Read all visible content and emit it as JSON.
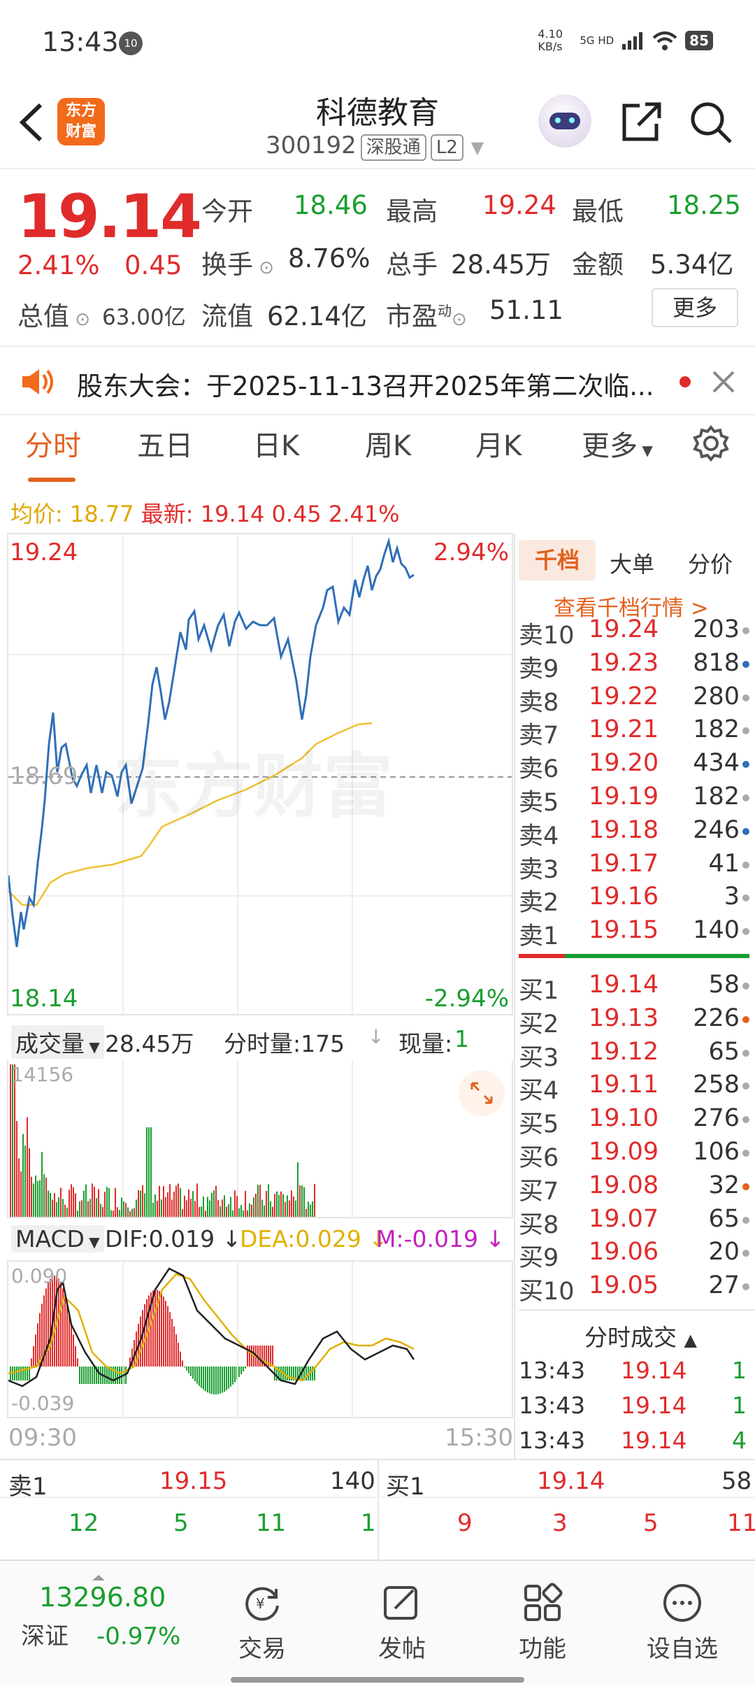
{
  "status": {
    "time": "13:43",
    "badge": "10",
    "net_speed": "4.10 KB/s",
    "signal": "5G HD",
    "battery": "85"
  },
  "header": {
    "title": "科德教育",
    "code": "300192",
    "tags": [
      "深股通",
      "L2"
    ],
    "logo_line1": "东方",
    "logo_line2": "财富"
  },
  "quote": {
    "price": "19.14",
    "change_pct": "2.41%",
    "change": "0.45",
    "open_label": "今开",
    "open": "18.46",
    "high_label": "最高",
    "high": "19.24",
    "low_label": "最低",
    "low": "18.25",
    "turnover_label": "换手",
    "turnover": "8.76%",
    "volume_label": "总手",
    "volume": "28.45万",
    "amount_label": "金额",
    "amount": "5.34亿",
    "mktcap_label": "总值",
    "mktcap": "63.00亿",
    "float_label": "流值",
    "float_cap": "62.14亿",
    "pe_label": "市盈",
    "pe_sup": "动",
    "pe": "51.11",
    "more": "更多"
  },
  "banner": {
    "text": "股东大会：于2025-11-13召开2025年第二次临..."
  },
  "tabs": [
    "分时",
    "五日",
    "日K",
    "周K",
    "月K",
    "更多"
  ],
  "avg_row": {
    "avg_label": "均价:",
    "avg": "18.77",
    "latest_label": "最新:",
    "latest": "19.14",
    "chg": "0.45",
    "pct": "2.41%"
  },
  "chart_labels": {
    "top_price": "19.24",
    "top_pct": "2.94%",
    "mid_price": "18.69",
    "bottom_price": "18.14",
    "bottom_pct": "-2.94%",
    "watermark": "东方财富",
    "start_time": "09:30",
    "end_time": "15:30"
  },
  "vol_bar": {
    "label": "成交量",
    "total": "28.45万",
    "fsl": "分时量:175",
    "now_label": "现量:",
    "now": "1",
    "max": "14156"
  },
  "macd": {
    "label": "MACD",
    "dif": "DIF:0.019",
    "dea": "DEA:0.029",
    "m": "M:-0.019",
    "top": "0.090",
    "bottom": "-0.039"
  },
  "side_tabs": [
    "千档",
    "大单",
    "分价"
  ],
  "side_link": "查看千档行情 >",
  "asks": [
    {
      "l": "卖10",
      "p": "19.24",
      "v": "203"
    },
    {
      "l": "卖9",
      "p": "19.23",
      "v": "818"
    },
    {
      "l": "卖8",
      "p": "19.22",
      "v": "280"
    },
    {
      "l": "卖7",
      "p": "19.21",
      "v": "182"
    },
    {
      "l": "卖6",
      "p": "19.20",
      "v": "434"
    },
    {
      "l": "卖5",
      "p": "19.19",
      "v": "182"
    },
    {
      "l": "卖4",
      "p": "19.18",
      "v": "246"
    },
    {
      "l": "卖3",
      "p": "19.17",
      "v": "41"
    },
    {
      "l": "卖2",
      "p": "19.16",
      "v": "3"
    },
    {
      "l": "卖1",
      "p": "19.15",
      "v": "140"
    }
  ],
  "bids": [
    {
      "l": "买1",
      "p": "19.14",
      "v": "58"
    },
    {
      "l": "买2",
      "p": "19.13",
      "v": "226"
    },
    {
      "l": "买3",
      "p": "19.12",
      "v": "65"
    },
    {
      "l": "买4",
      "p": "19.11",
      "v": "258"
    },
    {
      "l": "买5",
      "p": "19.10",
      "v": "276"
    },
    {
      "l": "买6",
      "p": "19.09",
      "v": "106"
    },
    {
      "l": "买7",
      "p": "19.08",
      "v": "32"
    },
    {
      "l": "买8",
      "p": "19.07",
      "v": "65"
    },
    {
      "l": "买9",
      "p": "19.06",
      "v": "20"
    },
    {
      "l": "买10",
      "p": "19.05",
      "v": "27"
    }
  ],
  "ticks_title": "分时成交",
  "ticks": [
    {
      "t": "13:43",
      "p": "19.14",
      "v": "1"
    },
    {
      "t": "13:43",
      "p": "19.14",
      "v": "1"
    },
    {
      "t": "13:43",
      "p": "19.14",
      "v": "4"
    }
  ],
  "level1": {
    "sell_label": "卖1",
    "sell_price": "19.15",
    "sell_vol": "140",
    "sell_queue": [
      "12",
      "5",
      "11",
      "1"
    ],
    "buy_label": "买1",
    "buy_price": "19.14",
    "buy_vol": "58",
    "buy_queue": [
      "9",
      "3",
      "5",
      "11"
    ]
  },
  "index": {
    "value": "13296.80",
    "name": "深证",
    "pct": "-0.97%"
  },
  "nav": [
    "交易",
    "发帖",
    "功能",
    "设自选"
  ]
}
